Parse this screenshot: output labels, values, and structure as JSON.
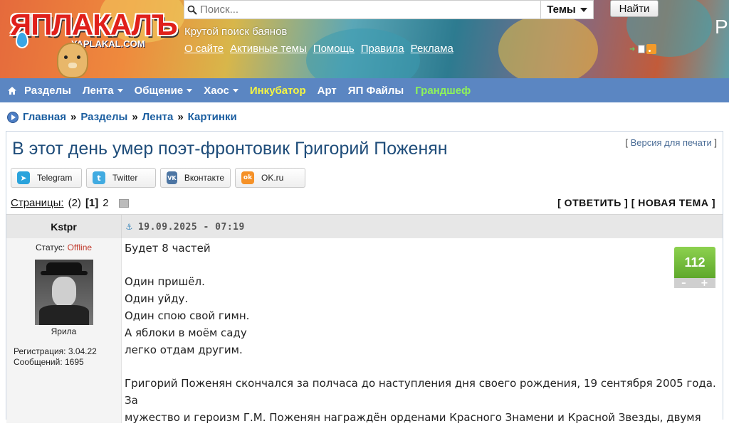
{
  "header": {
    "logo_text": "ЯПЛАКАЛЪ",
    "logo_sub": "YAPLAKAL.COM",
    "search_placeholder": "Поиск...",
    "search_scope": "Темы",
    "find_button": "Найти",
    "tagline": "Крутой поиск баянов",
    "links": [
      "О сайте",
      "Активные темы",
      "Помощь",
      "Правила",
      "Реклама"
    ],
    "right_logo": "Р"
  },
  "nav": {
    "items": [
      {
        "label": "Разделы",
        "dropdown": false,
        "color": "#ffffff"
      },
      {
        "label": "Лента",
        "dropdown": true,
        "color": "#ffffff"
      },
      {
        "label": "Общение",
        "dropdown": true,
        "color": "#ffffff"
      },
      {
        "label": "Хаос",
        "dropdown": true,
        "color": "#ffffff"
      },
      {
        "label": "Инкубатор",
        "dropdown": false,
        "color": "#f5f542"
      },
      {
        "label": "Арт",
        "dropdown": false,
        "color": "#ffffff"
      },
      {
        "label": "ЯП Файлы",
        "dropdown": false,
        "color": "#ffffff"
      },
      {
        "label": "Грандшеф",
        "dropdown": false,
        "color": "#8ef35a"
      }
    ]
  },
  "breadcrumb": [
    "Главная",
    "Разделы",
    "Лента",
    "Картинки"
  ],
  "topic": {
    "title": "В этот день умер поэт-фронтовик Григорий Поженян",
    "print_version": "Версия для печати",
    "share": [
      {
        "label": "Telegram",
        "icon": "telegram-icon",
        "color": "#2aa3dc",
        "glyph": "➤"
      },
      {
        "label": "Twitter",
        "icon": "twitter-icon",
        "color": "#41abe1",
        "glyph": "t"
      },
      {
        "label": "Вконтакте",
        "icon": "vk-icon",
        "color": "#4c75a3",
        "glyph": "VK"
      },
      {
        "label": "OK.ru",
        "icon": "ok-icon",
        "color": "#f59127",
        "glyph": "ok"
      }
    ],
    "pages_label": "Страницы:",
    "pages_count": "(2)",
    "current_page": "[1]",
    "other_page": "2",
    "reply": "[ ОТВЕТИТЬ ]",
    "new_topic": "[ НОВАЯ ТЕМА ]"
  },
  "post": {
    "author": "Kstpr",
    "date": "19.09.2025 - 07:19",
    "status_label": "Статус:",
    "status_value": "Offline",
    "avatar_caption": "Ярила",
    "registration": "Регистрация: 3.04.22",
    "messages": "Сообщений: 1695",
    "rating": "112",
    "vote_minus": "–",
    "vote_plus": "+",
    "lines": [
      "Будет 8 частей",
      "",
      "Один пришёл.",
      "Один уйду.",
      "Один спою свой гимн.",
      "А яблоки в моём саду",
      "легко отдам другим.",
      "",
      "Григорий Поженян скончался за полчаса до наступления дня своего рождения, 19 сентября 2005 года. За",
      "мужество и героизм Г.М. Поженян награждён орденами Красного Знамени и Красной Звезды, двумя"
    ]
  }
}
